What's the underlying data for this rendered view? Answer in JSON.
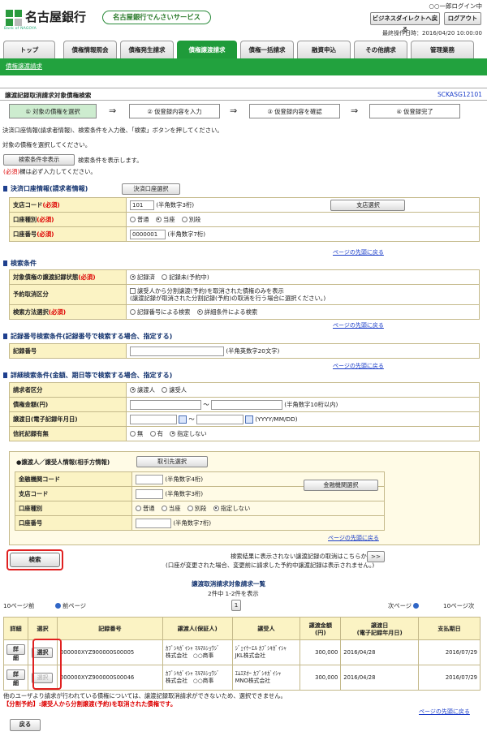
{
  "header": {
    "bank_name": "名古屋銀行",
    "bank_sub": "Bank of NAGOYA",
    "service_name": "名古屋銀行でんさいサービス",
    "user_name": "○○一郎ログイン中",
    "bizdirect_button": "ビジネスダイレクトへ戻る",
    "logout_button": "ログアウト",
    "last_operation": "最終操作日時：2016/04/20 10:00:00"
  },
  "tabs": [
    "トップ",
    "債権情報照会",
    "債権発生請求",
    "債権譲渡請求",
    "債権一括請求",
    "融資申込",
    "その他請求",
    "管理業務"
  ],
  "breadcrumb": "債権譲渡請求",
  "page_title": "譲渡記録取消請求対象債権検索",
  "screen_code": "SCKASG12101",
  "steps": [
    "① 対象の債権を選択",
    "② 仮登録内容を入力",
    "③ 仮登録内容を確認",
    "④ 仮登録完了"
  ],
  "arrow": "⇒",
  "instructions": {
    "line1": "決済口座情報(請求者情報)、検索条件を入力後、「検索」ボタンを押してください。",
    "line2": "対象の債権を選択してください。",
    "toggle_button": "検索条件非表示",
    "toggle_note": "検索条件を表示します。",
    "required_prefix": "(必須)",
    "required_note": "欄は必ず入力してください。"
  },
  "account_section": {
    "title": "決済口座情報(請求者情報)",
    "select_button": "決済口座選択",
    "branch_code_label": "支店コード",
    "branch_code_value": "101",
    "branch_code_hint": "(半角数字3桁)",
    "branch_select_button": "支店選択",
    "account_type_label": "口座種別",
    "account_types": [
      "普通",
      "当座",
      "別段"
    ],
    "account_no_label": "口座番号",
    "account_no_value": "0000001",
    "account_no_hint": "(半角数字7桁)",
    "required_mark": "(必須)"
  },
  "page_top_link": "ページの先頭に戻る",
  "search_section": {
    "title": "検索条件",
    "status_label": "対象債権の譲渡記録状態",
    "status_options": [
      "記録済",
      "記録未(予約中)"
    ],
    "reserve_label": "予約取消区分",
    "reserve_check": "譲受人から分割譲渡(予約)を取消された債権のみを表示",
    "reserve_note": "(譲渡記録が取消された分割記録(予約)の取消を行う場合に選択ください。)",
    "method_label": "検索方法選択",
    "method_options": [
      "記録番号による検索",
      "詳細条件による検索"
    ]
  },
  "record_section": {
    "title": "記録番号検索条件(記録番号で検索する場合、指定する)",
    "record_no_label": "記録番号",
    "record_no_hint": "(半角英数字20文字)"
  },
  "detail_section": {
    "title": "詳細検索条件(金額、期日等で検索する場合、指定する)",
    "party_label": "請求者区分",
    "party_options": [
      "譲渡人",
      "譲受人"
    ],
    "amount_label": "債権金額(円)",
    "amount_sep": "〜",
    "amount_hint": "(半角数字10桁以内)",
    "date_label": "譲渡日(電子記録年月日)",
    "date_hint": "(YYYY/MM/DD)",
    "trust_label": "信託記録有無",
    "trust_options": [
      "無",
      "有",
      "指定しない"
    ]
  },
  "party_box": {
    "title": "●譲渡人／譲受人情報(相手方情報)",
    "select_button": "取引先選択",
    "bank_code_label": "金融機関コード",
    "bank_code_hint": "(半角数字4桁)",
    "bank_select_button": "金融機関選択",
    "branch_code_label": "支店コード",
    "branch_code_hint": "(半角数字3桁)",
    "account_type_label": "口座種別",
    "account_types": [
      "普通",
      "当座",
      "別段",
      "指定しない"
    ],
    "account_no_label": "口座番号",
    "account_no_hint": "(半角数字7桁)"
  },
  "search_button": "検索",
  "cancel_link_text": "検索結果に表示されない譲渡記録の取消はこちらから",
  "cancel_link_button": ">>",
  "cancel_note": "(口座が変更された場合、変更前に請求した予約中譲渡記録は表示されません。)",
  "results": {
    "title": "譲渡取消請求対象請求一覧",
    "count": "2件中 1-2件を表示",
    "prev10": "10ページ前",
    "prev": "前ページ",
    "page": "1",
    "next": "次ページ",
    "next10": "10ページ次",
    "headers": [
      "詳細",
      "選択",
      "記録番号",
      "譲渡人(保証人)",
      "譲受人",
      "譲渡金額\n(円)",
      "譲渡日\n(電子記録年月日)",
      "支払期日"
    ],
    "detail_button": "詳細",
    "select_button": "選択",
    "rows": [
      {
        "record_no": "000000XYZ900000S00005",
        "assignor": "ｶﾌﾞｼｷｶﾞｲｼｬ ﾏﾙﾏﾙｼｮｳｼﾞ\n株式会社　○○商事",
        "assignee": "ｼﾞｪｲｹｰｴﾙ ｶﾌﾞｼｷｶﾞｲｼｬ\nJKL株式会社",
        "amount": "300,000",
        "date": "2016/04/28",
        "due": "2016/07/29",
        "select_enabled": true
      },
      {
        "record_no": "000000XYZ900000S00046",
        "assignor": "ｶﾌﾞｼｷｶﾞｲｼｬ ﾏﾙﾏﾙｼｮｳｼﾞ\n株式会社　○○商事",
        "assignee": "ｴﾑｴﾇｵｰ ｶﾌﾞｼｷｶﾞｲｼｬ\nMNO株式会社",
        "amount": "300,000",
        "date": "2016/04/28",
        "due": "2016/07/29",
        "select_enabled": false
      }
    ],
    "note1": "他のユーザより請求が行われている債権については、譲渡記録取消請求ができないため、選択できません。",
    "note2": "【分割予約】:譲受人から分割譲渡(予約)を取消された債権です。"
  },
  "back_button": "戻る"
}
